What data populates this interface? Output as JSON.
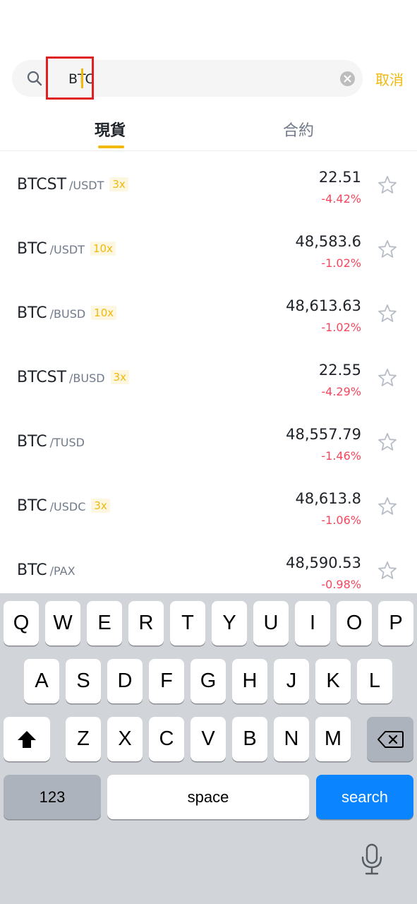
{
  "search": {
    "query": "BTC",
    "cancel_label": "取消"
  },
  "tabs": [
    {
      "label": "現貨",
      "active": true
    },
    {
      "label": "合約",
      "active": false
    }
  ],
  "pairs": [
    {
      "base": "BTCST",
      "quote": "/USDT",
      "leverage": "3x",
      "price": "22.51",
      "change": "-4.42%"
    },
    {
      "base": "BTC",
      "quote": "/USDT",
      "leverage": "10x",
      "price": "48,583.6",
      "change": "-1.02%"
    },
    {
      "base": "BTC",
      "quote": "/BUSD",
      "leverage": "10x",
      "price": "48,613.63",
      "change": "-1.02%"
    },
    {
      "base": "BTCST",
      "quote": "/BUSD",
      "leverage": "3x",
      "price": "22.55",
      "change": "-4.29%"
    },
    {
      "base": "BTC",
      "quote": "/TUSD",
      "leverage": "",
      "price": "48,557.79",
      "change": "-1.46%"
    },
    {
      "base": "BTC",
      "quote": "/USDC",
      "leverage": "3x",
      "price": "48,613.8",
      "change": "-1.06%"
    },
    {
      "base": "BTC",
      "quote": "/PAX",
      "leverage": "",
      "price": "48,590.53",
      "change": "-0.98%"
    }
  ],
  "keyboard": {
    "row1": [
      "Q",
      "W",
      "E",
      "R",
      "T",
      "Y",
      "U",
      "I",
      "O",
      "P"
    ],
    "row2": [
      "A",
      "S",
      "D",
      "F",
      "G",
      "H",
      "J",
      "K",
      "L"
    ],
    "row3": [
      "Z",
      "X",
      "C",
      "V",
      "B",
      "N",
      "M"
    ],
    "numbers_label": "123",
    "space_label": "space",
    "search_label": "search"
  },
  "colors": {
    "accent": "#f0b90b",
    "negative": "#f6465d",
    "keyboard_action": "#0a84ff"
  }
}
